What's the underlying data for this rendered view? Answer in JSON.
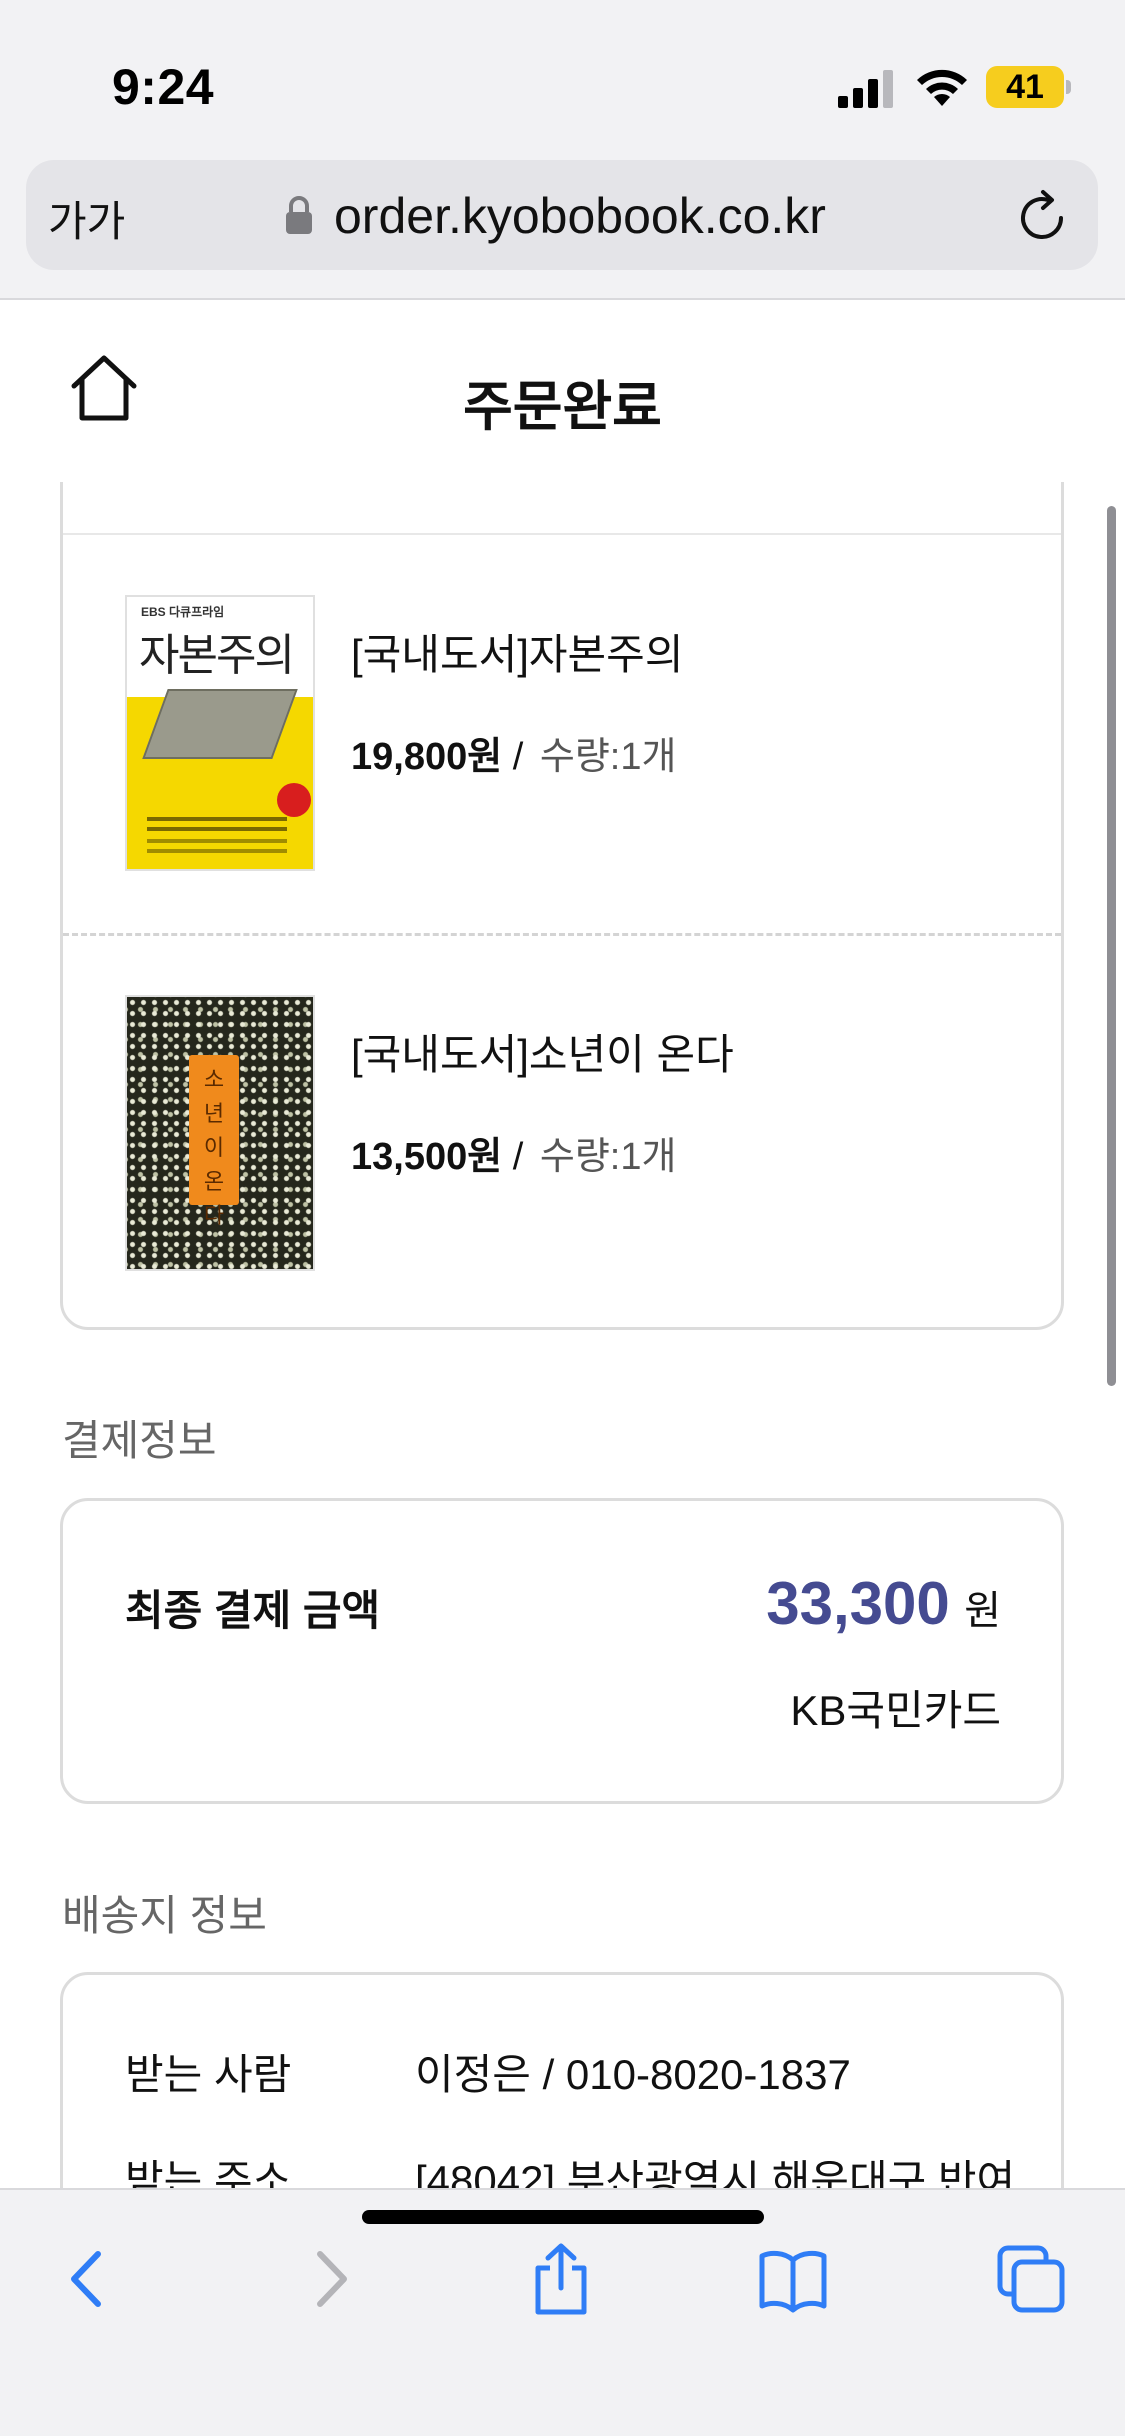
{
  "status_bar": {
    "time": "9:24",
    "battery": "41",
    "icons": [
      "signal-icon",
      "wifi-icon",
      "battery-icon"
    ]
  },
  "browser": {
    "text_size_button": "가가",
    "url": "order.kyobobook.co.kr",
    "icons": [
      "lock-icon",
      "reload-icon"
    ]
  },
  "header": {
    "title": "주문완료",
    "home_icon": "home-icon"
  },
  "order_items": [
    {
      "name": "[국내도서]자본주의",
      "price": "19,800원",
      "separator": "/",
      "quantity": "수량:1개",
      "cover_title": "자본주의",
      "cover_publisher": "EBS 다큐프라임"
    },
    {
      "name": "[국내도서]소년이 온다",
      "price": "13,500원",
      "separator": "/",
      "quantity": "수량:1개",
      "cover_title": "소년이 온다"
    }
  ],
  "payment": {
    "section_title": "결제정보",
    "total_label": "최종 결제 금액",
    "total_amount": "33,300",
    "currency": "원",
    "method": "KB국민카드",
    "amount_color": "#454b91"
  },
  "shipping": {
    "section_title": "배송지 정보",
    "recipient_label": "받는 사람",
    "recipient_value": "이정은 / 010-8020-1837",
    "address_label": "받는 주소",
    "address_value": "[48042] 부산광역시 해운대구 반여"
  },
  "toolbar": {
    "icons": [
      "back-icon",
      "forward-icon",
      "share-icon",
      "bookmarks-icon",
      "tabs-icon"
    ]
  }
}
